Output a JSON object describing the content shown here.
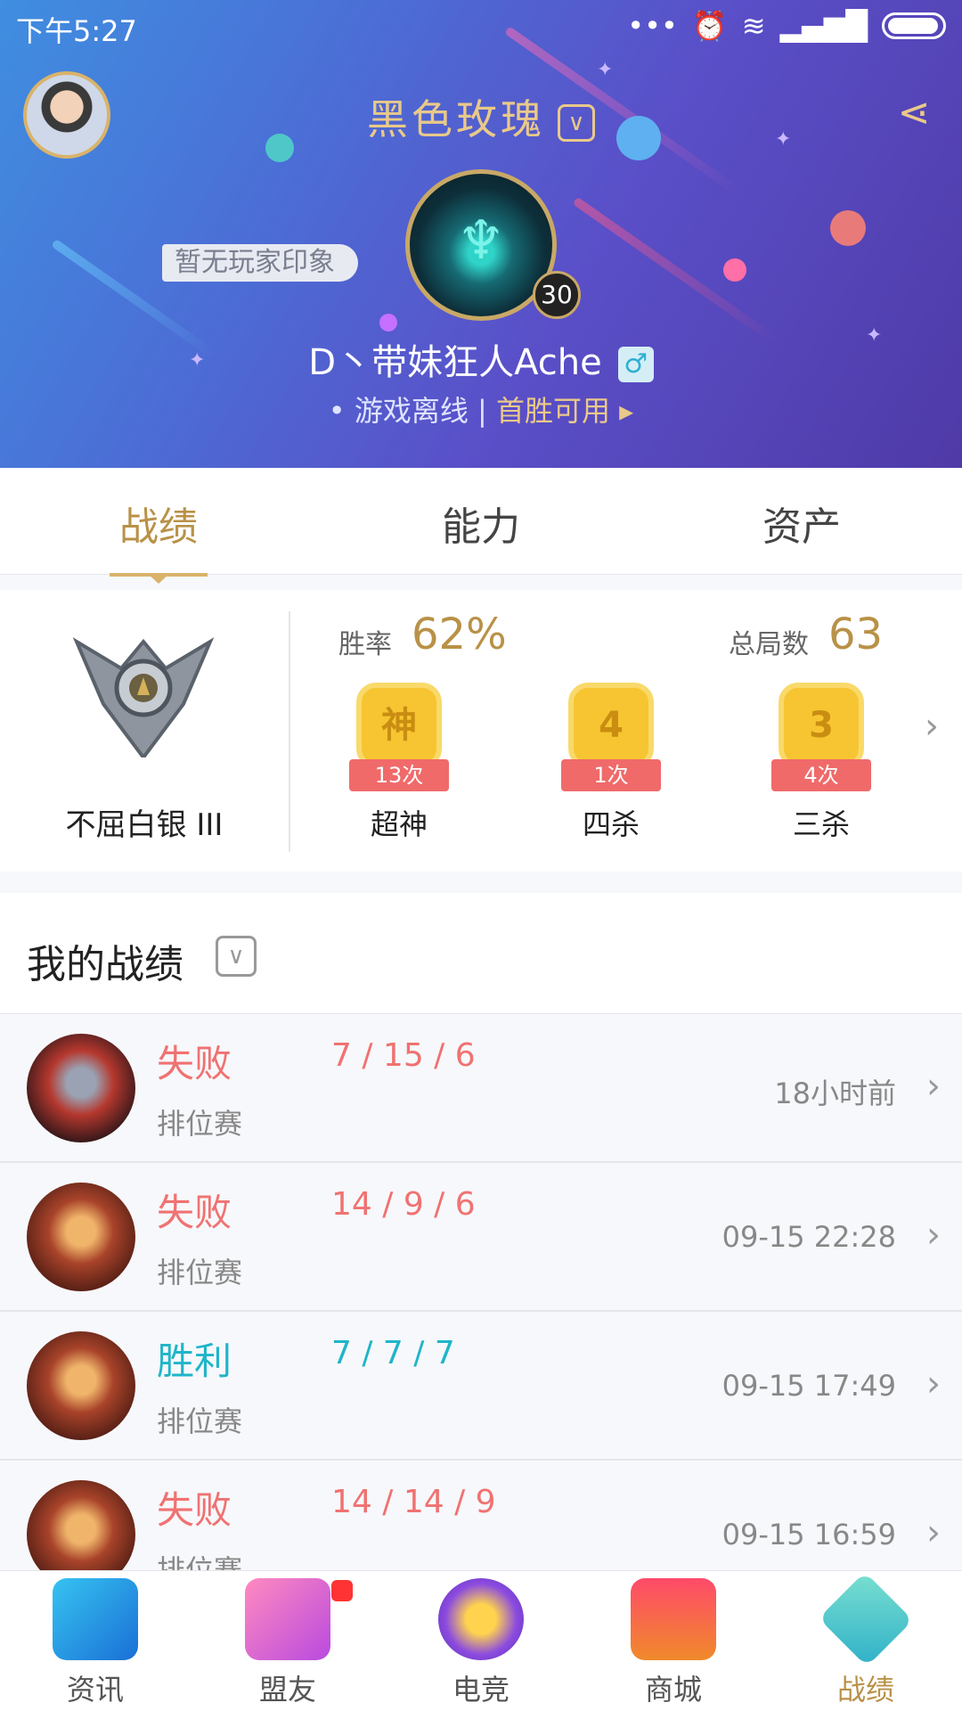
{
  "status_bar": {
    "time": "下午5:27"
  },
  "header": {
    "title": "黑色玫瑰",
    "impression": "暂无玩家印象",
    "level": "30",
    "player_name": "D丶带妹狂人Ache",
    "gender_symbol": "♂",
    "status": "游戏离线",
    "separator": "|",
    "first_win": "首胜可用"
  },
  "tabs": [
    {
      "label": "战绩",
      "active": true
    },
    {
      "label": "能力",
      "active": false
    },
    {
      "label": "资产",
      "active": false
    }
  ],
  "stats": {
    "tier": "不屈白银 III",
    "win_rate_label": "胜率",
    "win_rate": "62%",
    "total_games_label": "总局数",
    "total_games": "63",
    "badges": [
      {
        "glyph": "神",
        "count": "13次",
        "name": "超神"
      },
      {
        "glyph": "4",
        "count": "1次",
        "name": "四杀"
      },
      {
        "glyph": "3",
        "count": "4次",
        "name": "三杀"
      }
    ]
  },
  "my_record": {
    "title": "我的战绩"
  },
  "matches": [
    {
      "result": "失败",
      "outcome": "lose",
      "mode": "排位赛",
      "kda": "7 / 15 / 6",
      "time": "18小时前"
    },
    {
      "result": "失败",
      "outcome": "lose",
      "mode": "排位赛",
      "kda": "14 / 9 / 6",
      "time": "09-15 22:28"
    },
    {
      "result": "胜利",
      "outcome": "win",
      "mode": "排位赛",
      "kda": "7 / 7 / 7",
      "time": "09-15 17:49"
    },
    {
      "result": "失败",
      "outcome": "lose",
      "mode": "排位赛",
      "kda": "14 / 14 / 9",
      "time": "09-15 16:59"
    }
  ],
  "bottom_nav": [
    {
      "label": "资讯",
      "icon": "news-book-icon"
    },
    {
      "label": "盟友",
      "icon": "friends-heart-icon"
    },
    {
      "label": "电竞",
      "icon": "esports-trophy-icon"
    },
    {
      "label": "商城",
      "icon": "shop-chest-icon"
    },
    {
      "label": "战绩",
      "icon": "record-emblem-icon",
      "active": true
    }
  ],
  "colors": {
    "gold": "#b99147",
    "lose": "#f07272",
    "win": "#1fb5c8"
  }
}
